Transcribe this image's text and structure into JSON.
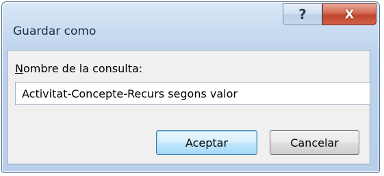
{
  "dialog": {
    "title": "Guardar como",
    "help_glyph": "?",
    "close_glyph": "X"
  },
  "form": {
    "label_accesskey": "N",
    "label_rest": "ombre de la consulta:",
    "query_name_value": "Activitat-Concepte-Recurs segons valor"
  },
  "buttons": {
    "ok_label": "Aceptar",
    "cancel_label": "Cancelar"
  }
}
